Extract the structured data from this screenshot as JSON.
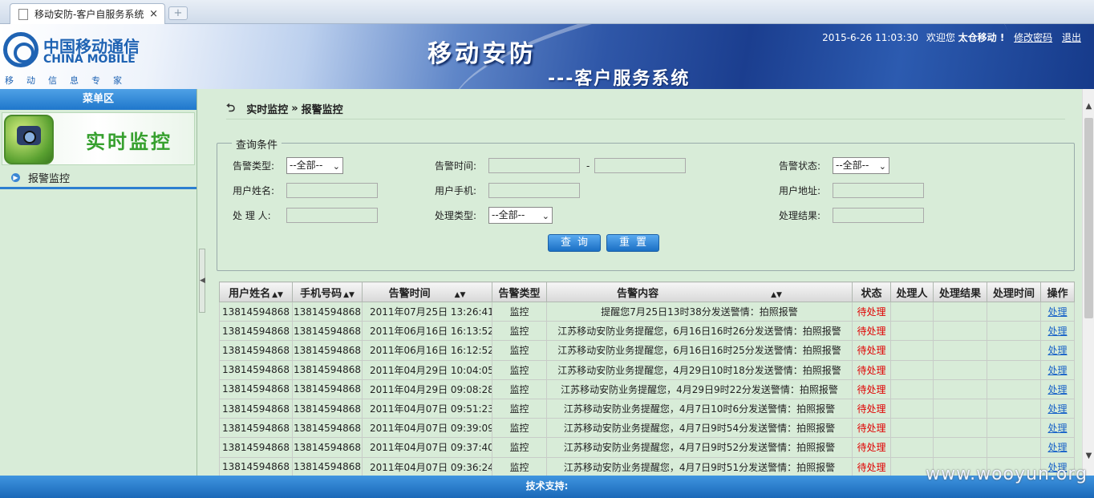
{
  "browser": {
    "tab_title": "移动安防-客户自服务系统",
    "tab_close": "×",
    "new_tab": "+"
  },
  "header": {
    "logo_cn": "中国移动通信",
    "logo_en": "CHINA MOBILE",
    "logo_slogan": "移动信息专家",
    "app_title": "移动安防",
    "app_subtitle": "---客户服务系统",
    "datetime": "2015-6-26 11:03:30",
    "welcome": "欢迎您",
    "username": "太仓移动 !",
    "change_password": "修改密码",
    "logout": "退出"
  },
  "sidebar": {
    "menu_head": "菜单区",
    "banner_text": "实时监控",
    "item_label": "报警监控",
    "item_icon": "arrow-circle-icon"
  },
  "breadcrumb": {
    "parent": "实时监控",
    "separator": "»",
    "current": "报警监控"
  },
  "query": {
    "legend": "查询条件",
    "alarm_type_label": "告警类型:",
    "alarm_type_value": "--全部--",
    "alarm_time_label": "告警时间:",
    "alarm_time_sep": "-",
    "alarm_status_label": "告警状态:",
    "alarm_status_value": "--全部--",
    "user_name_label": "用户姓名:",
    "user_phone_label": "用户手机:",
    "user_address_label": "用户地址:",
    "handler_label": "处 理 人:",
    "handle_type_label": "处理类型:",
    "handle_type_value": "--全部--",
    "handle_result_label": "处理结果:",
    "search_button": "查询",
    "reset_button": "重置"
  },
  "table": {
    "headers": [
      "用户姓名",
      "手机号码",
      "告警时间",
      "告警类型",
      "告警内容",
      "状态",
      "处理人",
      "处理结果",
      "处理时间",
      "操作"
    ],
    "rows": [
      {
        "name": "13814594868",
        "phone": "13814594868",
        "time": "2011年07月25日  13:26:41",
        "type": "监控",
        "content": "提醒您7月25日13时38分发送警情：拍照报警",
        "status": "待处理",
        "handler": "",
        "result": "",
        "handle_time": "",
        "action": "处理"
      },
      {
        "name": "13814594868",
        "phone": "13814594868",
        "time": "2011年06月16日  16:13:52",
        "type": "监控",
        "content": "江苏移动安防业务提醒您，6月16日16时26分发送警情：拍照报警",
        "status": "待处理",
        "handler": "",
        "result": "",
        "handle_time": "",
        "action": "处理"
      },
      {
        "name": "13814594868",
        "phone": "13814594868",
        "time": "2011年06月16日  16:12:52",
        "type": "监控",
        "content": "江苏移动安防业务提醒您，6月16日16时25分发送警情：拍照报警",
        "status": "待处理",
        "handler": "",
        "result": "",
        "handle_time": "",
        "action": "处理"
      },
      {
        "name": "13814594868",
        "phone": "13814594868",
        "time": "2011年04月29日  10:04:05",
        "type": "监控",
        "content": "江苏移动安防业务提醒您，4月29日10时18分发送警情：拍照报警",
        "status": "待处理",
        "handler": "",
        "result": "",
        "handle_time": "",
        "action": "处理"
      },
      {
        "name": "13814594868",
        "phone": "13814594868",
        "time": "2011年04月29日  09:08:28",
        "type": "监控",
        "content": "江苏移动安防业务提醒您，4月29日9时22分发送警情：拍照报警",
        "status": "待处理",
        "handler": "",
        "result": "",
        "handle_time": "",
        "action": "处理"
      },
      {
        "name": "13814594868",
        "phone": "13814594868",
        "time": "2011年04月07日  09:51:23",
        "type": "监控",
        "content": "江苏移动安防业务提醒您，4月7日10时6分发送警情：拍照报警",
        "status": "待处理",
        "handler": "",
        "result": "",
        "handle_time": "",
        "action": "处理"
      },
      {
        "name": "13814594868",
        "phone": "13814594868",
        "time": "2011年04月07日  09:39:09",
        "type": "监控",
        "content": "江苏移动安防业务提醒您，4月7日9时54分发送警情：拍照报警",
        "status": "待处理",
        "handler": "",
        "result": "",
        "handle_time": "",
        "action": "处理"
      },
      {
        "name": "13814594868",
        "phone": "13814594868",
        "time": "2011年04月07日  09:37:40",
        "type": "监控",
        "content": "江苏移动安防业务提醒您，4月7日9时52分发送警情：拍照报警",
        "status": "待处理",
        "handler": "",
        "result": "",
        "handle_time": "",
        "action": "处理"
      },
      {
        "name": "13814594868",
        "phone": "13814594868",
        "time": "2011年04月07日  09:36:24",
        "type": "监控",
        "content": "江苏移动安防业务提醒您，4月7日9时51分发送警情：拍照报警",
        "status": "待处理",
        "handler": "",
        "result": "",
        "handle_time": "",
        "action": "处理"
      }
    ]
  },
  "footer": {
    "text": "技术支持:"
  },
  "watermark": "www.wooyun.org"
}
